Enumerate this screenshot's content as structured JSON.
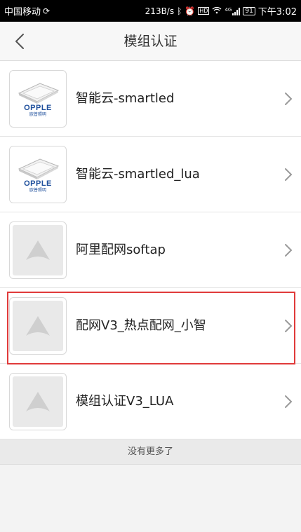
{
  "status_bar": {
    "carrier": "中国移动",
    "net_speed": "213B/s",
    "signal": "4G",
    "battery": "91",
    "time": "下午3:02"
  },
  "navbar": {
    "back_icon": "chevron-left-icon",
    "title": "模组认证"
  },
  "modules": [
    {
      "label": "智能云-smartled",
      "icon": "opple-logo"
    },
    {
      "label": "智能云-smartled_lua",
      "icon": "opple-logo"
    },
    {
      "label": "阿里配网softap",
      "icon": "placeholder-a-icon"
    },
    {
      "label": "配网V3_热点配网_小智",
      "icon": "placeholder-a-icon",
      "highlighted": true
    },
    {
      "label": "模组认证V3_LUA",
      "icon": "placeholder-a-icon"
    }
  ],
  "logo_text": {
    "brand": "OPPLE",
    "sub": "欧普照明"
  },
  "footer": {
    "no_more": "没有更多了"
  },
  "colors": {
    "highlight": "#e03a3a",
    "brand_blue": "#1e4f9c",
    "background": "#f3f3f3"
  }
}
